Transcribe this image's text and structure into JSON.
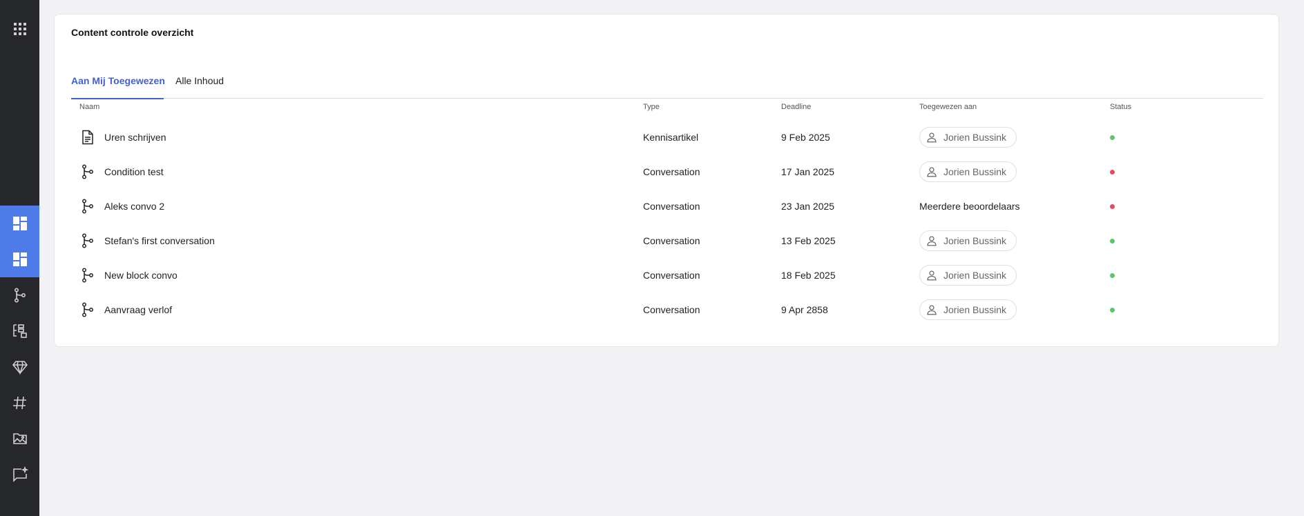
{
  "sidebar": {
    "items": [
      {
        "icon": "grid-icon",
        "active": false
      },
      {
        "icon": "dashboard-icon",
        "active": true
      },
      {
        "icon": "dashboard-icon",
        "active": true
      },
      {
        "icon": "branch-icon",
        "active": false
      },
      {
        "icon": "flow-icon",
        "active": false
      },
      {
        "icon": "diamond-icon",
        "active": false
      },
      {
        "icon": "hash-icon",
        "active": false
      },
      {
        "icon": "image-folder-icon",
        "active": false
      },
      {
        "icon": "chat-sparkle-icon",
        "active": false
      }
    ]
  },
  "card": {
    "title": "Content controle overzicht"
  },
  "tabs": [
    {
      "label": "Aan Mij Toegewezen",
      "active": true
    },
    {
      "label": "Alle Inhoud",
      "active": false
    }
  ],
  "table": {
    "headers": {
      "name": "Naam",
      "type": "Type",
      "deadline": "Deadline",
      "assignee": "Toegewezen aan",
      "status": "Status"
    },
    "rows": [
      {
        "icon": "document-icon",
        "name": "Uren schrijven",
        "type": "Kennisartikel",
        "deadline": "9 Feb 2025",
        "assignee": "Jorien Bussink",
        "assignee_chip": true,
        "status": "green"
      },
      {
        "icon": "branch-icon",
        "name": "Condition test",
        "type": "Conversation",
        "deadline": "17 Jan 2025",
        "assignee": "Jorien Bussink",
        "assignee_chip": true,
        "status": "red"
      },
      {
        "icon": "branch-icon",
        "name": "Aleks convo 2",
        "type": "Conversation",
        "deadline": "23 Jan 2025",
        "assignee": "Meerdere beoordelaars",
        "assignee_chip": false,
        "status": "red"
      },
      {
        "icon": "branch-icon",
        "name": "Stefan's first conversation",
        "type": "Conversation",
        "deadline": "13 Feb 2025",
        "assignee": "Jorien Bussink",
        "assignee_chip": true,
        "status": "green"
      },
      {
        "icon": "branch-icon",
        "name": "New block convo",
        "type": "Conversation",
        "deadline": "18 Feb 2025",
        "assignee": "Jorien Bussink",
        "assignee_chip": true,
        "status": "green"
      },
      {
        "icon": "branch-icon",
        "name": "Aanvraag verlof",
        "type": "Conversation",
        "deadline": "9 Apr 2858",
        "assignee": "Jorien Bussink",
        "assignee_chip": true,
        "status": "green"
      }
    ]
  },
  "colors": {
    "accent": "#4360d3",
    "sidebar_bg": "#26272b",
    "sidebar_active": "#4f7be8",
    "status_green": "#5cc46a",
    "status_red": "#e2505a"
  }
}
